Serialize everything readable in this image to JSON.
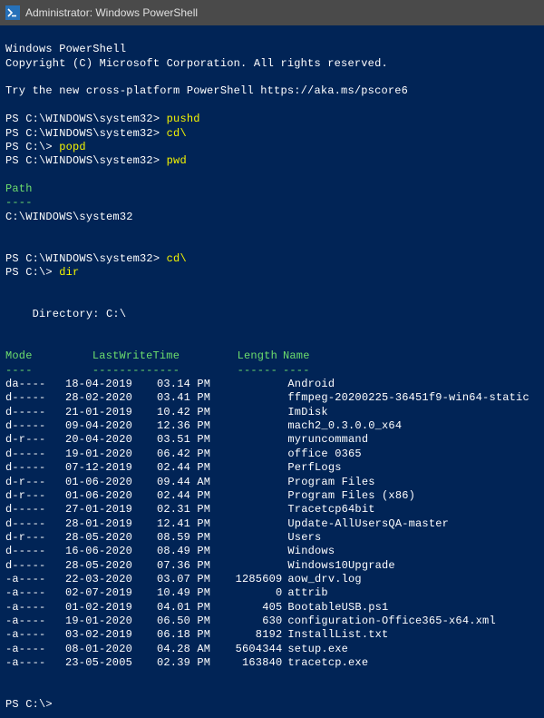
{
  "window": {
    "title": "Administrator: Windows PowerShell"
  },
  "banner": {
    "line1": "Windows PowerShell",
    "line2": "Copyright (C) Microsoft Corporation. All rights reserved.",
    "try": "Try the new cross-platform PowerShell https://aka.ms/pscore6"
  },
  "prompts": {
    "p1_prefix": "PS C:\\WINDOWS\\system32> ",
    "p1_cmd": "pushd",
    "p2_prefix": "PS C:\\WINDOWS\\system32> ",
    "p2_cmd": "cd\\",
    "p3_prefix": "PS C:\\> ",
    "p3_cmd": "popd",
    "p4_prefix": "PS C:\\WINDOWS\\system32> ",
    "p4_cmd": "pwd",
    "p5_prefix": "PS C:\\WINDOWS\\system32> ",
    "p5_cmd": "cd\\",
    "p6_prefix": "PS C:\\> ",
    "p6_cmd": "dir",
    "p7_prefix": "PS C:\\> "
  },
  "pwd_output": {
    "header": "Path",
    "dash": "----",
    "value": "C:\\WINDOWS\\system32"
  },
  "dir_output": {
    "title": "    Directory: C:\\",
    "headers": {
      "mode": "Mode",
      "lwt": "LastWriteTime",
      "length": "Length",
      "name": "Name",
      "dash_mode": "----",
      "dash_lwt": "-------------",
      "dash_length": "------",
      "dash_name": "----"
    },
    "rows": [
      {
        "mode": "da----",
        "date": "18-04-2019",
        "time": "03.14",
        "ampm": "PM",
        "length": "",
        "name": "Android"
      },
      {
        "mode": "d-----",
        "date": "28-02-2020",
        "time": "03.41",
        "ampm": "PM",
        "length": "",
        "name": "ffmpeg-20200225-36451f9-win64-static"
      },
      {
        "mode": "d-----",
        "date": "21-01-2019",
        "time": "10.42",
        "ampm": "PM",
        "length": "",
        "name": "ImDisk"
      },
      {
        "mode": "d-----",
        "date": "09-04-2020",
        "time": "12.36",
        "ampm": "PM",
        "length": "",
        "name": "mach2_0.3.0.0_x64"
      },
      {
        "mode": "d-r---",
        "date": "20-04-2020",
        "time": "03.51",
        "ampm": "PM",
        "length": "",
        "name": "myruncommand"
      },
      {
        "mode": "d-----",
        "date": "19-01-2020",
        "time": "06.42",
        "ampm": "PM",
        "length": "",
        "name": "office 0365"
      },
      {
        "mode": "d-----",
        "date": "07-12-2019",
        "time": "02.44",
        "ampm": "PM",
        "length": "",
        "name": "PerfLogs"
      },
      {
        "mode": "d-r---",
        "date": "01-06-2020",
        "time": "09.44",
        "ampm": "AM",
        "length": "",
        "name": "Program Files"
      },
      {
        "mode": "d-r---",
        "date": "01-06-2020",
        "time": "02.44",
        "ampm": "PM",
        "length": "",
        "name": "Program Files (x86)"
      },
      {
        "mode": "d-----",
        "date": "27-01-2019",
        "time": "02.31",
        "ampm": "PM",
        "length": "",
        "name": "Tracetcp64bit"
      },
      {
        "mode": "d-----",
        "date": "28-01-2019",
        "time": "12.41",
        "ampm": "PM",
        "length": "",
        "name": "Update-AllUsersQA-master"
      },
      {
        "mode": "d-r---",
        "date": "28-05-2020",
        "time": "08.59",
        "ampm": "PM",
        "length": "",
        "name": "Users"
      },
      {
        "mode": "d-----",
        "date": "16-06-2020",
        "time": "08.49",
        "ampm": "PM",
        "length": "",
        "name": "Windows"
      },
      {
        "mode": "d-----",
        "date": "28-05-2020",
        "time": "07.36",
        "ampm": "PM",
        "length": "",
        "name": "Windows10Upgrade"
      },
      {
        "mode": "-a----",
        "date": "22-03-2020",
        "time": "03.07",
        "ampm": "PM",
        "length": "1285609",
        "name": "aow_drv.log"
      },
      {
        "mode": "-a----",
        "date": "02-07-2019",
        "time": "10.49",
        "ampm": "PM",
        "length": "0",
        "name": "attrib"
      },
      {
        "mode": "-a----",
        "date": "01-02-2019",
        "time": "04.01",
        "ampm": "PM",
        "length": "405",
        "name": "BootableUSB.ps1"
      },
      {
        "mode": "-a----",
        "date": "19-01-2020",
        "time": "06.50",
        "ampm": "PM",
        "length": "630",
        "name": "configuration-Office365-x64.xml"
      },
      {
        "mode": "-a----",
        "date": "03-02-2019",
        "time": "06.18",
        "ampm": "PM",
        "length": "8192",
        "name": "InstallList.txt"
      },
      {
        "mode": "-a----",
        "date": "08-01-2020",
        "time": "04.28",
        "ampm": "AM",
        "length": "5604344",
        "name": "setup.exe"
      },
      {
        "mode": "-a----",
        "date": "23-05-2005",
        "time": "02.39",
        "ampm": "PM",
        "length": "163840",
        "name": "tracetcp.exe"
      }
    ]
  }
}
